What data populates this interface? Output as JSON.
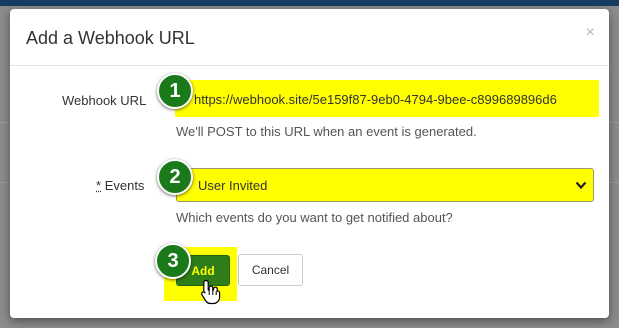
{
  "modal": {
    "title": "Add a Webhook URL",
    "close_glyph": "×"
  },
  "form": {
    "url_label": "Webhook URL",
    "url_value": "https://webhook.site/5e159f87-9eb0-4794-9bee-c899689896d6",
    "url_help": "We'll POST to this URL when an event is generated.",
    "events_required_mark": "*",
    "events_label": "Events",
    "events_selected": "User Invited",
    "events_help": "Which events do you want to get notified about?"
  },
  "buttons": {
    "add_label": "Add",
    "cancel_label": "Cancel"
  },
  "steps": [
    "1",
    "2",
    "3"
  ],
  "icons": {
    "close": "close-icon",
    "select_arrow": "chevron-down-icon",
    "cursor": "hand-pointer-icon"
  },
  "colors": {
    "header_bar": "#173c61",
    "highlight": "#ffff00",
    "step_badge": "#1a7a1a",
    "add_button": "#2e7d18"
  }
}
